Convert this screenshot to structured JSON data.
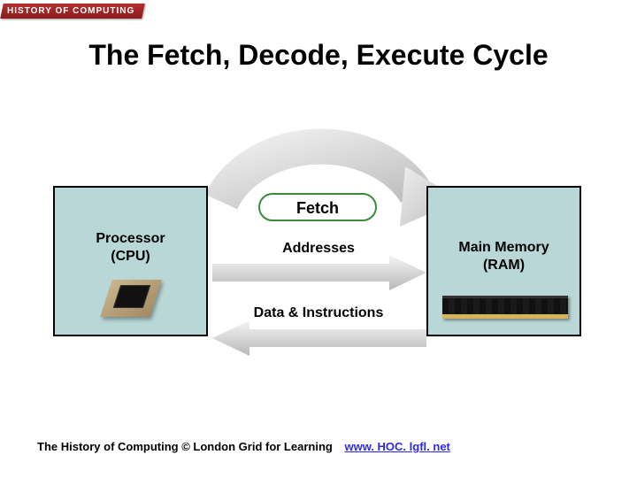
{
  "badge": "HISTORY OF COMPUTING",
  "title": "The Fetch, Decode, Execute Cycle",
  "stage_pill": "Fetch",
  "left_box": {
    "line1": "Processor",
    "line2": "(CPU)"
  },
  "right_box": {
    "line1": "Main Memory",
    "line2": "(RAM)"
  },
  "arrow_top_label": "Addresses",
  "arrow_bottom_label": "Data & Instructions",
  "footer_text": "The History of Computing © London Grid for Learning",
  "footer_link_text": "www. HOC. lgfl. net"
}
